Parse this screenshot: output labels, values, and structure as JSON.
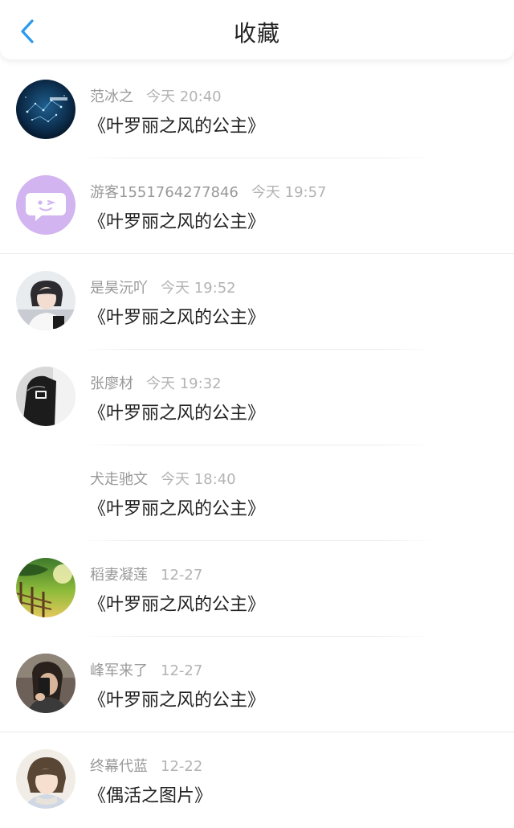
{
  "header": {
    "title": "收藏"
  },
  "items": [
    {
      "user": "范冰之",
      "time": "今天 20:40",
      "text": "《叶罗丽之风的公主》"
    },
    {
      "user": "游客1551764277846",
      "time": "今天 19:57",
      "text": "《叶罗丽之风的公主》"
    },
    {
      "user": "是昊沅吖",
      "time": "今天 19:52",
      "text": "《叶罗丽之风的公主》"
    },
    {
      "user": "张廖材",
      "time": "今天 19:32",
      "text": "《叶罗丽之风的公主》"
    },
    {
      "user": "犬走驰文",
      "time": "今天 18:40",
      "text": "《叶罗丽之风的公主》"
    },
    {
      "user": "稻妻凝莲",
      "time": "12-27",
      "text": "《叶罗丽之风的公主》"
    },
    {
      "user": "峰军来了",
      "time": "12-27",
      "text": "《叶罗丽之风的公主》"
    },
    {
      "user": "终幕代蓝",
      "time": "12-22",
      "text": "《偶活之图片》"
    }
  ],
  "colors": {
    "accent": "#1e90ff",
    "text_primary": "#222222",
    "text_secondary": "#999999"
  }
}
